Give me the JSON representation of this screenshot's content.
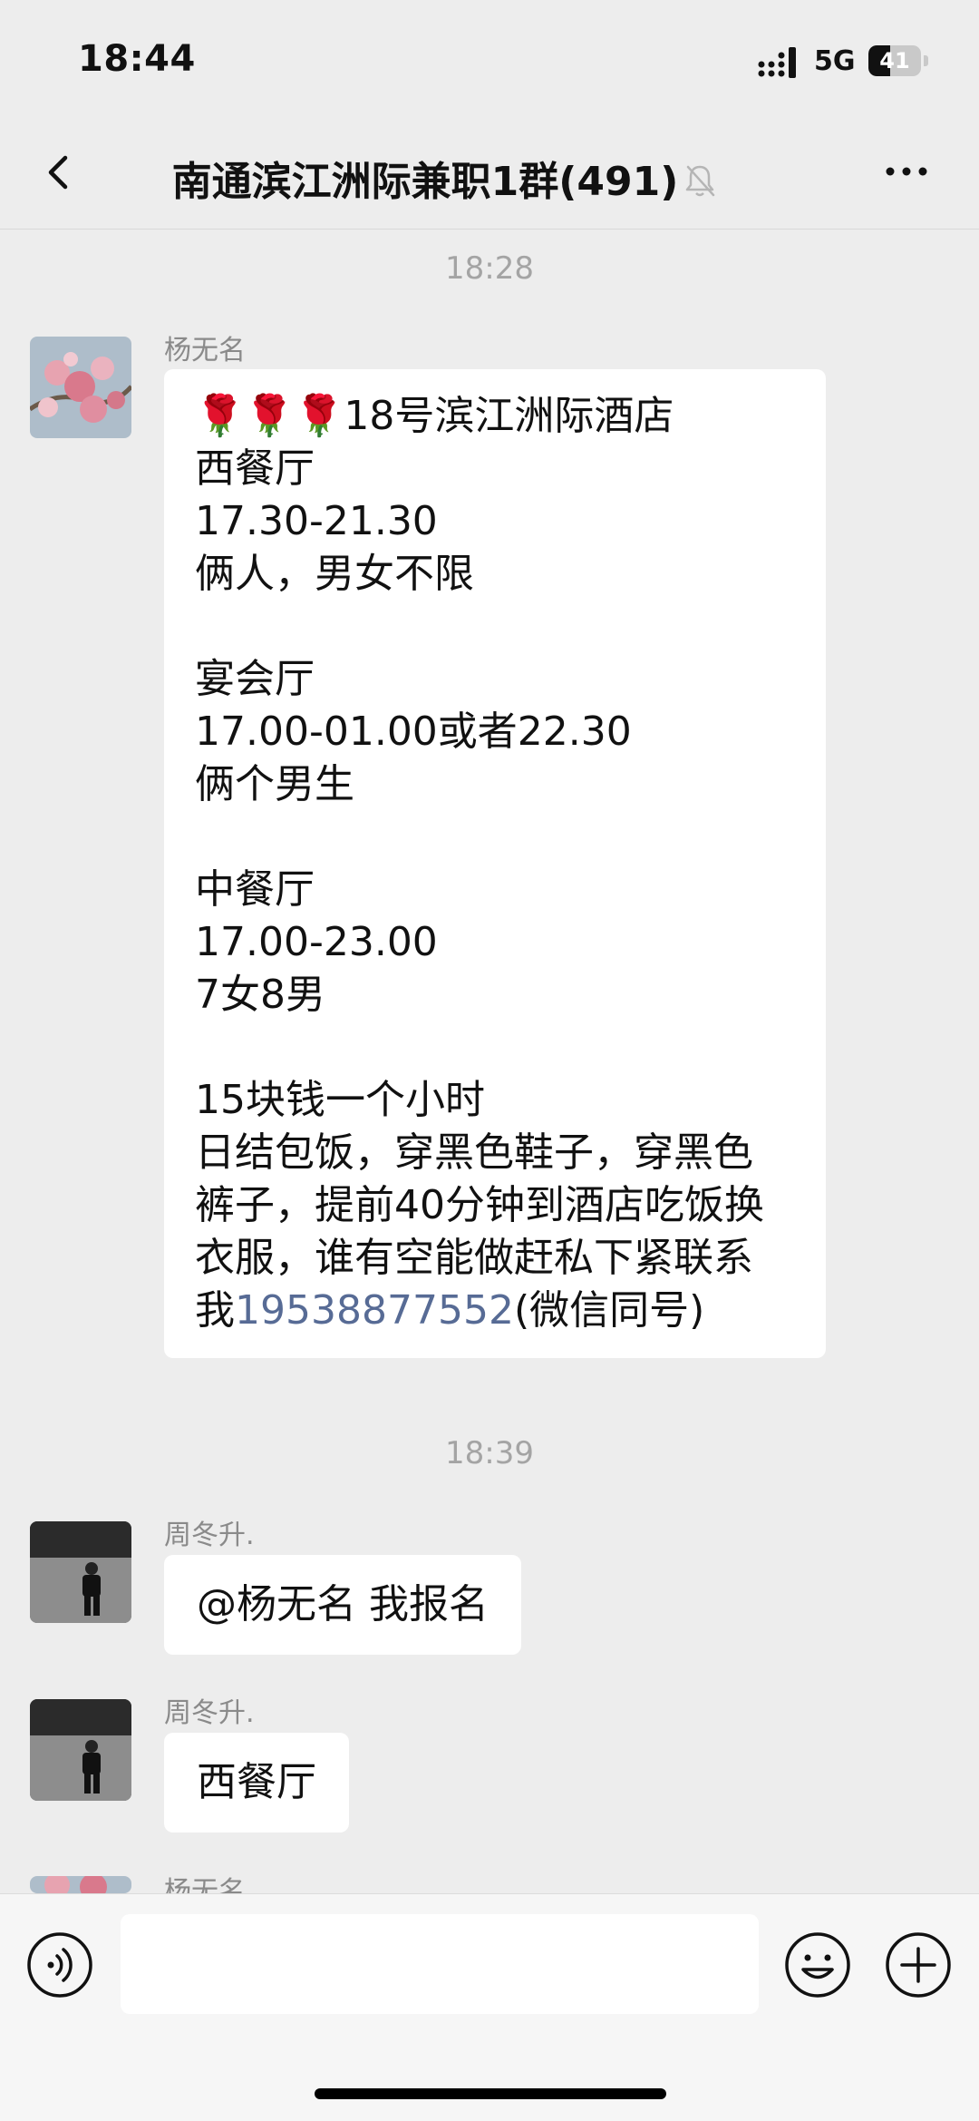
{
  "status_bar": {
    "time": "18:44",
    "network": "5G",
    "battery": "41",
    "battery_level": 0.41
  },
  "nav": {
    "title": "南通滨江洲际兼职1群(491)"
  },
  "messages": [
    {
      "timestamp": "18:28"
    },
    {
      "sender": "杨无名",
      "text": "🌹🌹🌹18号滨江洲际酒店\n西餐厅\n17.30-21.30\n俩人，男女不限\n\n宴会厅\n17.00-01.00或者22.30\n俩个男生\n\n中餐厅\n17.00-23.00\n7女8男\n\n15块钱一个小时\n日结包饭，穿黑色鞋子，穿黑色\n裤子，提前40分钟到酒店吃饭换\n衣服，谁有空能做赶私下紧联系\n我",
      "phone": "19538877552",
      "text_after": "(微信同号)"
    },
    {
      "timestamp": "18:39"
    },
    {
      "sender": "周冬升.",
      "text": "@杨无名 我报名"
    },
    {
      "sender": "周冬升.",
      "text": "西餐厅"
    },
    {
      "sender": "杨无名"
    }
  ],
  "icons": {
    "back": "chevron-left-icon",
    "mute": "bell-off-icon",
    "more": "more-dots-icon",
    "voice": "voice-icon",
    "emoji": "emoji-icon",
    "plus": "plus-icon"
  },
  "colors": {
    "background": "#ededed",
    "link": "#576b95",
    "bubble": "#ffffff"
  }
}
